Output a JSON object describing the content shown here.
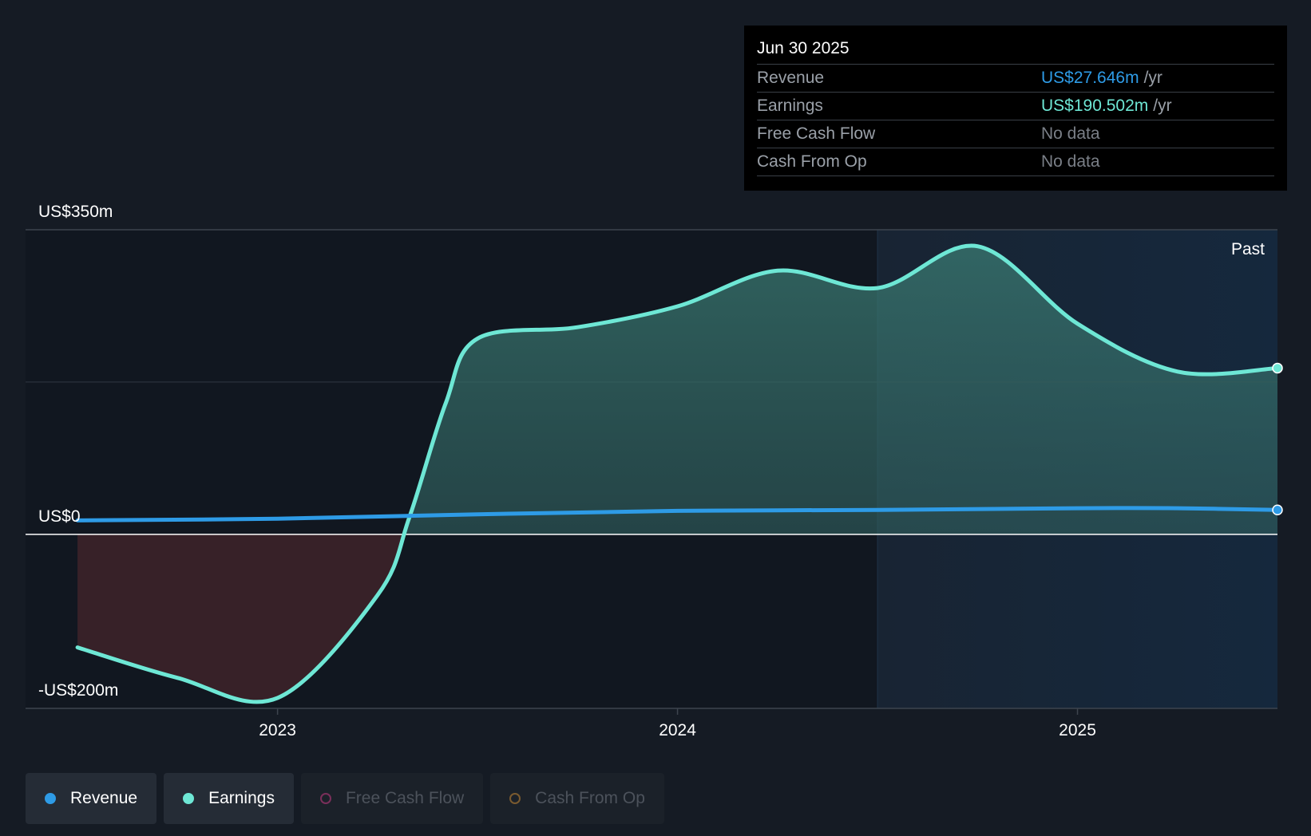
{
  "tooltip": {
    "date": "Jun 30 2025",
    "rows": [
      {
        "label": "Revenue",
        "value": "US$27.646m",
        "unit": "/yr",
        "color": "#2e9be6"
      },
      {
        "label": "Earnings",
        "value": "US$190.502m",
        "unit": "/yr",
        "color": "#6ee7d5"
      },
      {
        "label": "Free Cash Flow",
        "value": "No data",
        "unit": "",
        "color": "#7a7f87"
      },
      {
        "label": "Cash From Op",
        "value": "No data",
        "unit": "",
        "color": "#7a7f87"
      }
    ]
  },
  "legend": [
    {
      "label": "Revenue",
      "color": "#2e9be6",
      "active": true
    },
    {
      "label": "Earnings",
      "color": "#6ee7d5",
      "active": true
    },
    {
      "label": "Free Cash Flow",
      "color": "#7a2f5a",
      "active": false
    },
    {
      "label": "Cash From Op",
      "color": "#7a5a2f",
      "active": false
    }
  ],
  "chart_data": {
    "type": "area",
    "past_label": "Past",
    "y_ticks": [
      {
        "value": 350,
        "label": "US$350m"
      },
      {
        "value": 0,
        "label": "US$0"
      },
      {
        "value": -200,
        "label": "-US$200m"
      }
    ],
    "ylim": [
      -200,
      350
    ],
    "x_ticks": [
      {
        "value": 2023.0,
        "label": "2023"
      },
      {
        "value": 2024.0,
        "label": "2024"
      },
      {
        "value": 2025.0,
        "label": "2025"
      }
    ],
    "xlim": [
      2022.37,
      2025.5
    ],
    "past_start": 2024.5,
    "series": [
      {
        "name": "Revenue",
        "color": "#2e9be6",
        "x": [
          2022.5,
          2023.0,
          2023.5,
          2024.0,
          2024.5,
          2025.0,
          2025.25,
          2025.5
        ],
        "y": [
          16,
          18,
          23,
          27,
          28,
          30,
          30,
          28
        ]
      },
      {
        "name": "Earnings",
        "color": "#6ee7d5",
        "x": [
          2022.5,
          2022.75,
          2023.0,
          2023.25,
          2023.33,
          2023.42,
          2023.5,
          2023.75,
          2024.0,
          2024.25,
          2024.5,
          2024.75,
          2025.0,
          2025.25,
          2025.5
        ],
        "y": [
          -130,
          -165,
          -188,
          -70,
          20,
          150,
          225,
          238,
          262,
          303,
          283,
          331,
          242,
          187,
          191
        ]
      }
    ]
  }
}
